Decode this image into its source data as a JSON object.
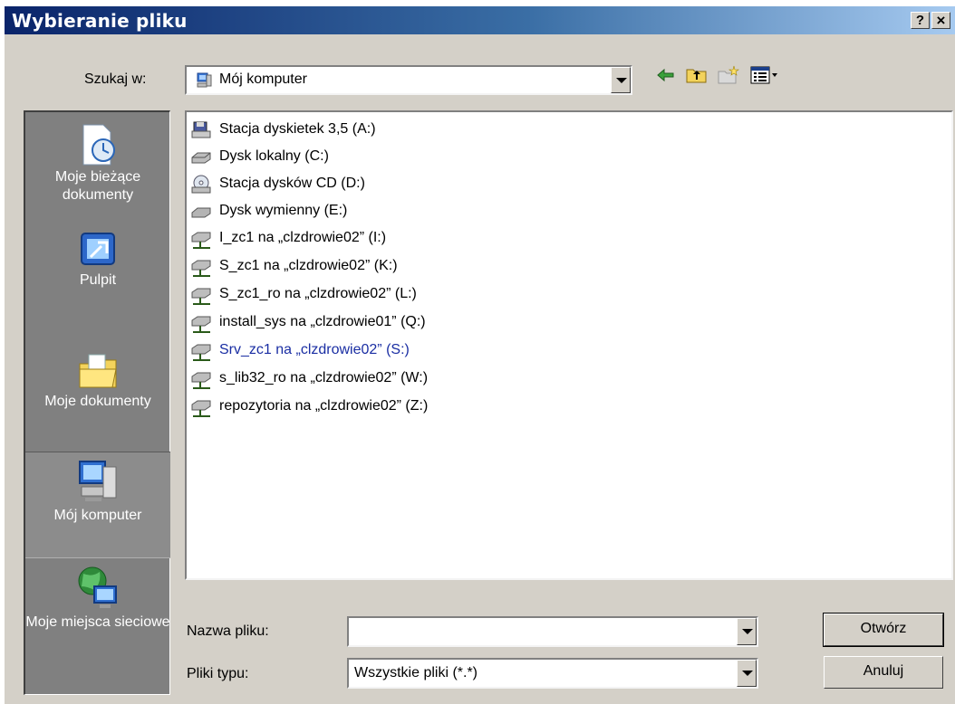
{
  "dialog": {
    "title": "Wybieranie pliku",
    "help_label": "?",
    "close_label": "×"
  },
  "lookin": {
    "label": "Szukaj w:",
    "value": "Mój komputer"
  },
  "toolbar": {
    "icons": [
      "back-arrow-icon",
      "up-folder-icon",
      "new-folder-icon",
      "view-menu-icon"
    ]
  },
  "places": [
    {
      "label": "Moje bieżące dokumenty",
      "icon": "recent-documents-icon"
    },
    {
      "label": "Pulpit",
      "icon": "desktop-icon"
    },
    {
      "label": "Moje dokumenty",
      "icon": "my-documents-icon"
    },
    {
      "label": "Mój komputer",
      "icon": "my-computer-icon",
      "selected": true
    },
    {
      "label": "Moje miejsca sieciowe",
      "icon": "network-places-icon"
    }
  ],
  "files": [
    {
      "label": "Stacja dyskietek 3,5 (A:)",
      "icon": "floppy-drive-icon"
    },
    {
      "label": "Dysk lokalny (C:)",
      "icon": "hard-drive-icon"
    },
    {
      "label": "Stacja dysków CD (D:)",
      "icon": "cd-drive-icon"
    },
    {
      "label": "Dysk wymienny (E:)",
      "icon": "removable-drive-icon"
    },
    {
      "label": "I_zc1 na „clzdrowie02” (I:)",
      "icon": "network-drive-icon"
    },
    {
      "label": "S_zc1 na „clzdrowie02” (K:)",
      "icon": "network-drive-icon"
    },
    {
      "label": "S_zc1_ro na „clzdrowie02” (L:)",
      "icon": "network-drive-icon"
    },
    {
      "label": "install_sys na „clzdrowie01” (Q:)",
      "icon": "network-drive-icon"
    },
    {
      "label": "Srv_zc1 na „clzdrowie02” (S:)",
      "icon": "network-drive-icon",
      "highlighted": true
    },
    {
      "label": "s_lib32_ro na „clzdrowie02” (W:)",
      "icon": "network-drive-icon"
    },
    {
      "label": "repozytoria na „clzdrowie02” (Z:)",
      "icon": "network-drive-icon"
    }
  ],
  "filename": {
    "label": "Nazwa pliku:",
    "value": ""
  },
  "filetype": {
    "label": "Pliki typu:",
    "value": "Wszystkie pliki (*.*)"
  },
  "buttons": {
    "open": "Otwórz",
    "cancel": "Anuluj"
  },
  "colors": {
    "title_start": "#0a246a",
    "title_end": "#a6caf0",
    "dialog_bg": "#d4d0c8",
    "places_bg": "#808080",
    "highlight_text": "#1a2ea3"
  }
}
